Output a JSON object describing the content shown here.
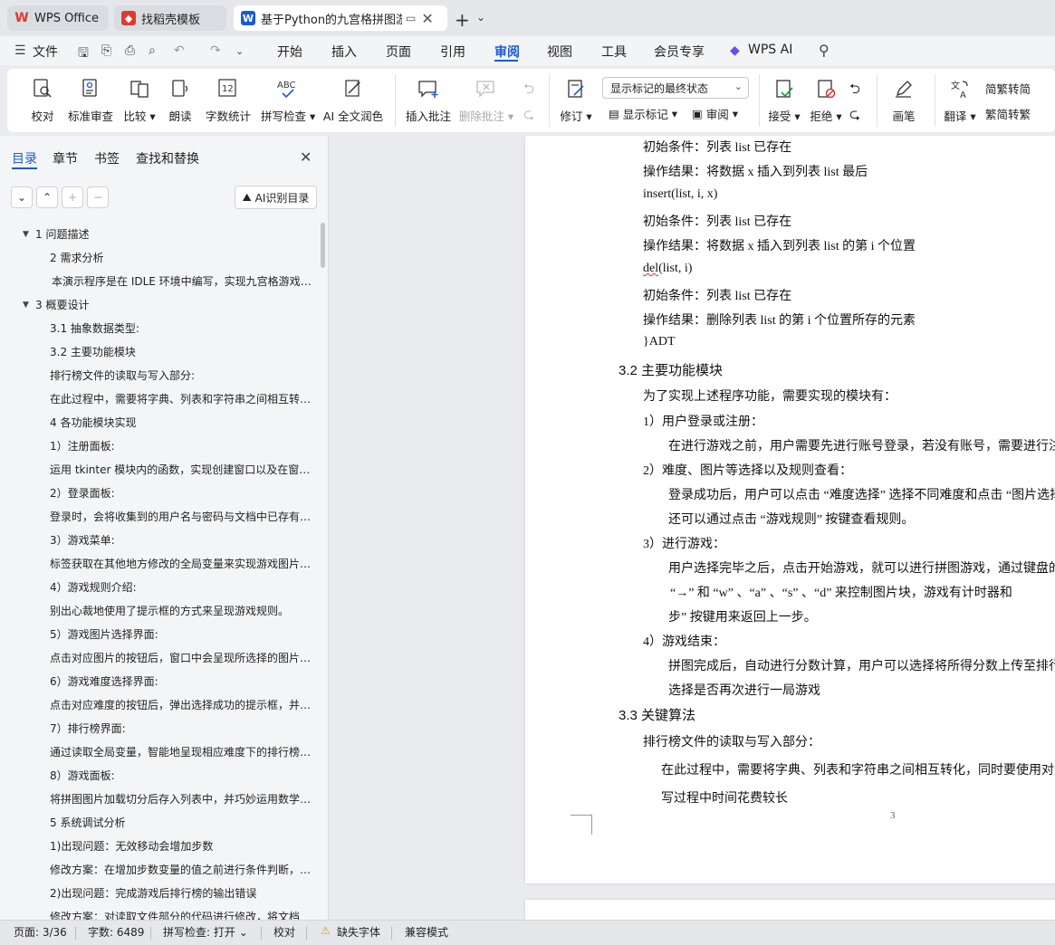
{
  "tabs": [
    {
      "label": "WPS Office",
      "icon": "wps-logo-icon",
      "color": "#e03a2f"
    },
    {
      "label": "找稻壳模板",
      "icon": "docer-icon",
      "color": "#e03a2f"
    },
    {
      "label": "基于Python的九宫格拼图游戏",
      "icon": "writer-icon",
      "color": "#1a5ad8"
    }
  ],
  "menubar": {
    "items": [
      "文件",
      "开始",
      "插入",
      "页面",
      "引用",
      "审阅",
      "视图",
      "工具",
      "会员专享",
      "WPS AI"
    ],
    "active": "审阅"
  },
  "ribbon": {
    "proofread": "校对",
    "standard_review": "标准审查",
    "compare": "比较",
    "read_aloud": "朗读",
    "word_count": "字数统计",
    "spell_check": "拼写检查",
    "ai_polish": "AI 全文润色",
    "insert_comment": "插入批注",
    "delete_comment": "删除批注",
    "track_changes": "修订",
    "show_markup_select": "显示标记的最终状态",
    "show_markup": "显示标记",
    "review_pane": "审阅",
    "accept": "接受",
    "reject": "拒绝",
    "pen": "画笔",
    "translate": "翻译",
    "to_simplified": "繁转简",
    "to_traditional": "简转繁",
    "abc_label": "ABC",
    "count_label": "12"
  },
  "navpane": {
    "tabs": [
      "目录",
      "章节",
      "书签",
      "查找和替换"
    ],
    "active_tab": "目录",
    "ai_toc_button": "AI识别目录",
    "toc": [
      {
        "text": "1  问题描述",
        "level": 0,
        "arrow": true
      },
      {
        "text": "2  需求分析",
        "level": 1,
        "arrow": false
      },
      {
        "text": "本演示程序是在 IDLE 环境中编写，实现九宫格游戏的拼图游戏功能…",
        "level": 1,
        "arrow": false
      },
      {
        "text": "3  概要设计",
        "level": 0,
        "arrow": true
      },
      {
        "text": "3.1 抽象数据类型:",
        "level": 1,
        "arrow": false
      },
      {
        "text": "3.2  主要功能模块",
        "level": 1,
        "arrow": false
      },
      {
        "text": "排行榜文件的读取与写入部分:",
        "level": 1,
        "arrow": false
      },
      {
        "text": "在此过程中，需要将字典、列表和字符串之间相互转化，同时要使用…",
        "level": 1,
        "arrow": false
      },
      {
        "text": "4 各功能模块实现",
        "level": 1,
        "arrow": false
      },
      {
        "text": "1）注册面板:",
        "level": 1,
        "arrow": false
      },
      {
        "text": "运用 tkinter 模块内的函数，实现创建窗口以及在窗口上添加按钮…",
        "level": 1,
        "arrow": false
      },
      {
        "text": "2）登录面板:",
        "level": 1,
        "arrow": false
      },
      {
        "text": "登录时，会将收集到的用户名与密码与文档中已存有的账号密码比对…",
        "level": 1,
        "arrow": false
      },
      {
        "text": "3）游戏菜单:",
        "level": 1,
        "arrow": false
      },
      {
        "text": "标签获取在其他地方修改的全局变量来实现游戏图片与难度的显示…",
        "level": 1,
        "arrow": false
      },
      {
        "text": "4）游戏规则介绍:",
        "level": 1,
        "arrow": false
      },
      {
        "text": "别出心裁地使用了提示框的方式来呈现游戏规则。",
        "level": 1,
        "arrow": false
      },
      {
        "text": "5）游戏图片选择界面:",
        "level": 1,
        "arrow": false
      },
      {
        "text": "点击对应图片的按钮后，窗口中会呈现所选择的图片，并提示选择成功…",
        "level": 1,
        "arrow": false
      },
      {
        "text": "6）游戏难度选择界面:",
        "level": 1,
        "arrow": false
      },
      {
        "text": "点击对应难度的按钮后，弹出选择成功的提示框，并修改全局变量…",
        "level": 1,
        "arrow": false
      },
      {
        "text": "7）排行榜界面:",
        "level": 1,
        "arrow": false
      },
      {
        "text": "通过读取全局变量，智能地呈现相应难度下的排行榜，并按分数排序…",
        "level": 1,
        "arrow": false
      },
      {
        "text": "8）游戏面板:",
        "level": 1,
        "arrow": false
      },
      {
        "text": "将拼图图片加载切分后存入列表中，并巧妙运用数学方法实现拼图…",
        "level": 1,
        "arrow": false
      },
      {
        "text": "5  系统调试分析",
        "level": 1,
        "arrow": false
      },
      {
        "text": "1)出现问题：无效移动会增加步数",
        "level": 1,
        "arrow": false
      },
      {
        "text": "修改方案：在增加步数变量的值之前进行条件判断，若移动无效则不…",
        "level": 1,
        "arrow": false
      },
      {
        "text": "2)出现问题：完成游戏后排行榜的输出错误",
        "level": 1,
        "arrow": false
      },
      {
        "text": "修改方案：对读取文件部分的代码进行修改，将文档",
        "level": 1,
        "arrow": false
      }
    ]
  },
  "document": {
    "lines": [
      "初始条件：列表 list 已存在",
      "操作结果：将数据 x 插入到列表 list 最后",
      "insert(list, i, x)",
      "初始条件：列表 list 已存在",
      "操作结果：将数据 x 插入到列表 list 的第 i 个位置",
      "(list, i)",
      "初始条件：列表 list 已存在",
      "操作结果：删除列表 list 的第 i 个位置所存的元素",
      "}ADT"
    ],
    "del_word": "del",
    "heading_32": "3.2  主要功能模块",
    "intro": "为了实现上述程序功能，需要实现的模块有：",
    "m1_title": "1）用户登录或注册：",
    "m1_body": "在进行游戏之前，用户需要先进行账号登录，若没有账号，需要进行注册",
    "m2_title": "2）难度、图片等选择以及规则查看：",
    "m2_body1": "登录成功后，用户可以点击 “难度选择” 选择不同难度和点击 “图片选择”",
    "m2_body2": "还可以通过点击 “游戏规则” 按键查看规则。",
    "m3_title": "3）进行游戏：",
    "m3_body1": "用户选择完毕之后，点击开始游戏，就可以进行拼图游戏，通过键盘的",
    "m3_body2": "“→” 和 “w” 、“a” 、“s” 、“d” 来控制图片块，游戏有计时器和",
    "m3_body3": "步” 按键用来返回上一步。",
    "m4_title": "4）游戏结束：",
    "m4_body1": "拼图完成后，自动进行分数计算，用户可以选择将所得分数上传至排行榜",
    "m4_body2": "选择是否再次进行一局游戏",
    "heading_33": "3.3 关键算法",
    "alg_title": "排行榜文件的读取与写入部分：",
    "alg_body1": "在此过程中，需要将字典、列表和字符串之间相互转化，同时要使用对文件",
    "alg_body2": "写过程中时间花费较长",
    "page_number": "3"
  },
  "statusbar": {
    "page": "页面: 3/36",
    "words": "字数: 6489",
    "spell": "拼写检查: 打开",
    "proof": "校对",
    "missing_font": "缺失字体",
    "compat": "兼容模式"
  }
}
